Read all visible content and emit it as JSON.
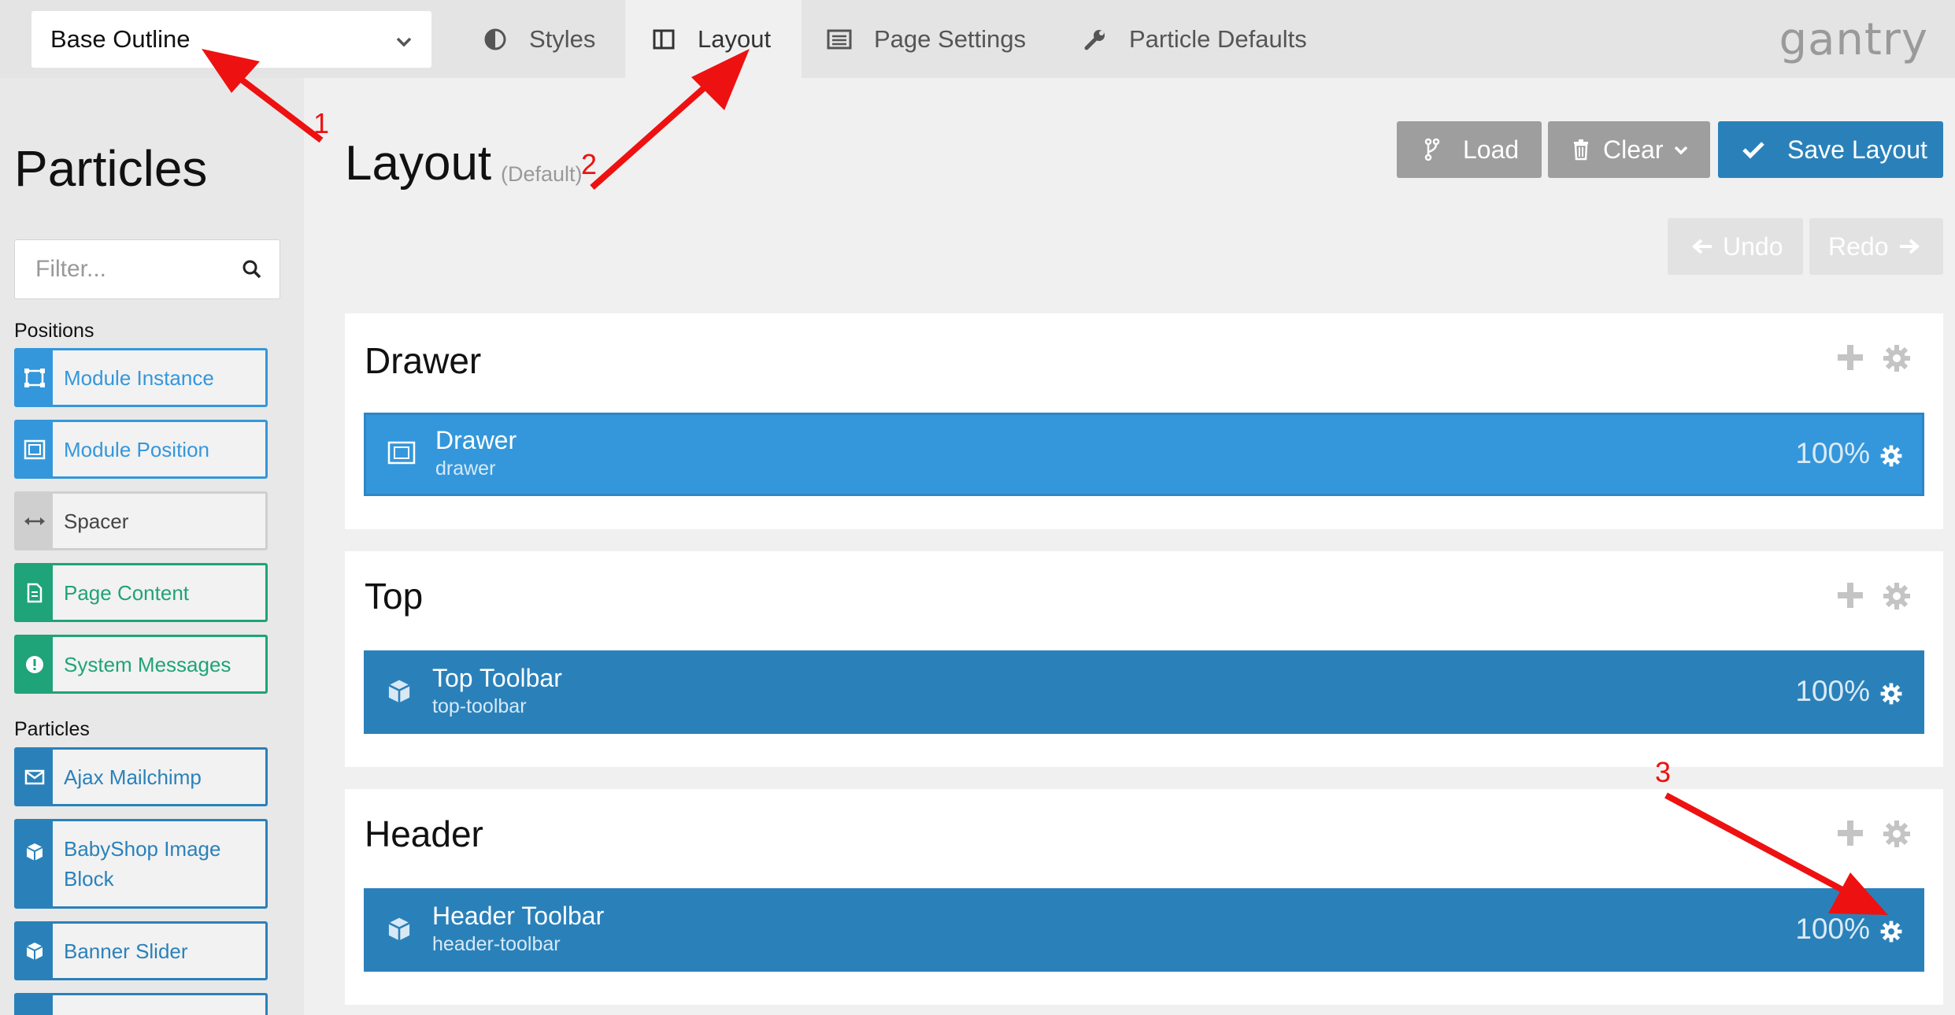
{
  "topbar": {
    "outline_select": "Base Outline",
    "tabs": [
      {
        "label": "Styles",
        "icon": "contrast-icon"
      },
      {
        "label": "Layout",
        "icon": "columns-icon"
      },
      {
        "label": "Page Settings",
        "icon": "list-alt-icon"
      },
      {
        "label": "Particle Defaults",
        "icon": "wrench-icon"
      }
    ],
    "brand": "gantry"
  },
  "sidebar": {
    "title": "Particles",
    "filter_placeholder": "Filter...",
    "positions_label": "Positions",
    "positions": [
      {
        "label": "Module Instance",
        "icon": "module-instance-icon"
      },
      {
        "label": "Module Position",
        "icon": "module-position-icon"
      },
      {
        "label": "Spacer",
        "icon": "arrows-h-icon"
      },
      {
        "label": "Page Content",
        "icon": "file-icon"
      },
      {
        "label": "System Messages",
        "icon": "exclamation-circle-icon"
      }
    ],
    "particles_label": "Particles",
    "particles": [
      {
        "label": "Ajax Mailchimp",
        "icon": "envelope-icon"
      },
      {
        "label": "BabyShop Image Block",
        "line1": "BabyShop Image",
        "line2": "Block",
        "icon": "cube-icon"
      },
      {
        "label": "Banner Slider",
        "icon": "cube-icon"
      }
    ]
  },
  "main": {
    "title": "Layout",
    "subtitle": "(Default)",
    "buttons": {
      "load": "Load",
      "clear": "Clear",
      "save": "Save Layout",
      "undo": "Undo",
      "redo": "Redo"
    },
    "sections": [
      {
        "title": "Drawer",
        "block": {
          "title": "Drawer",
          "subtitle": "drawer",
          "percent": "100%"
        }
      },
      {
        "title": "Top",
        "block": {
          "title": "Top Toolbar",
          "subtitle": "top-toolbar",
          "percent": "100%"
        }
      },
      {
        "title": "Header",
        "block": {
          "title": "Header Toolbar",
          "subtitle": "header-toolbar",
          "percent": "100%"
        }
      }
    ]
  },
  "annotations": {
    "labels": [
      "1",
      "2",
      "3"
    ],
    "color": "#ee1111"
  },
  "colors": {
    "accent_blue": "#2a81ba",
    "light_blue": "#3497db",
    "green": "#1fa378",
    "grey_button": "#9e9e9e"
  }
}
